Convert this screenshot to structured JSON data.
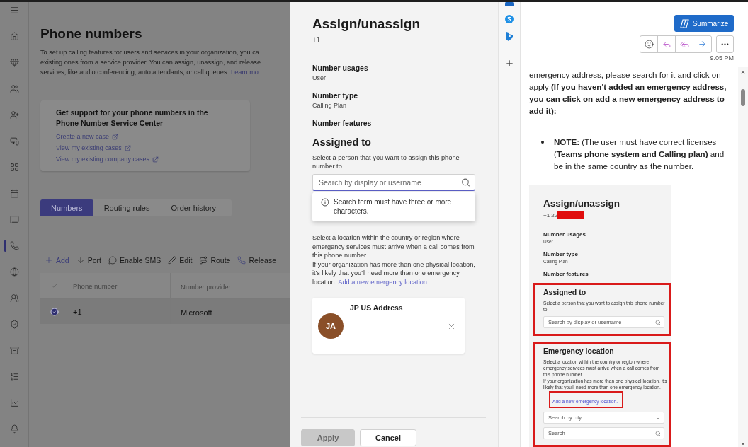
{
  "rail": {
    "items": [
      {
        "selected": false
      },
      {
        "selected": false
      },
      {
        "selected": false
      },
      {
        "selected": false
      },
      {
        "selected": false
      },
      {
        "selected": false
      },
      {
        "selected": false
      },
      {
        "selected": false
      },
      {
        "selected": false
      },
      {
        "selected": true
      },
      {
        "selected": false
      },
      {
        "selected": false
      },
      {
        "selected": false
      },
      {
        "selected": false
      },
      {
        "selected": false
      },
      {
        "selected": false
      },
      {
        "selected": false
      }
    ]
  },
  "admin": {
    "title": "Phone numbers",
    "description": [
      "To set up calling features for users and services in your organization, you ca",
      "existing ones from a service provider. You can assign, unassign, and release",
      "services, like audio conferencing, auto attendants, or call queues."
    ],
    "learn_more": "Learn mo",
    "support": {
      "title": "Get support for your phone numbers in the Phone Number Service Center",
      "links": [
        "Create a new case",
        "View my existing cases",
        "View my existing company cases"
      ]
    },
    "tabs": [
      {
        "label": "Numbers",
        "selected": true
      },
      {
        "label": "Routing rules",
        "selected": false
      },
      {
        "label": "Order history",
        "selected": false
      }
    ],
    "toolbar": [
      {
        "label": "Add",
        "kind": "add"
      },
      {
        "label": "Port",
        "kind": "port"
      },
      {
        "label": "Enable SMS",
        "kind": "sms"
      },
      {
        "label": "Edit",
        "kind": "edit"
      },
      {
        "label": "Route",
        "kind": "route"
      },
      {
        "label": "Release",
        "kind": "release"
      }
    ],
    "table": {
      "columns": [
        "Phone number",
        "Number provider"
      ],
      "rows": [
        {
          "selected": true,
          "cells": [
            "+1",
            "Microsoft"
          ]
        }
      ]
    }
  },
  "panel": {
    "title": "Assign/unassign",
    "number": "+1",
    "fields": [
      {
        "label": "Number usages",
        "value": "User"
      },
      {
        "label": "Number type",
        "value": "Calling Plan"
      },
      {
        "label": "Number features"
      }
    ],
    "assigned": {
      "heading": "Assigned to",
      "help": "Select a person that you want to assign this phone number to",
      "placeholder": "Search by display or username",
      "popup": "Search term must have three or more characters."
    },
    "emergency": {
      "description": "Select a location within the country or region where emergency services must arrive when a call comes from this phone number.",
      "more": "If your organization has more than one physical location, it's likely that you'll need more than one emergency location.",
      "link": "Add a new emergency location",
      "after_link": "."
    },
    "location": {
      "initials": "JA",
      "name": "JP US Address"
    },
    "buttons": [
      {
        "label": "Apply",
        "disabled": true
      },
      {
        "label": "Cancel",
        "disabled": false
      }
    ]
  },
  "email": {
    "summarize": "Summarize",
    "time": "9:05 PM",
    "paragraph": "emergency address, please search for it and click on apply **(If you haven't added an emergency address, you can click on add a new emergency address to add it):**",
    "note": "**NOTE:** (The user must have correct licenses (**Teams phone system and Calling plan)** and be in the same country as the number.",
    "screenshot": {
      "title": "Assign/unassign",
      "number": "+1 22",
      "fields": [
        {
          "label": "Number usages",
          "value": "User"
        },
        {
          "label": "Number type",
          "value": "Calling Plan"
        },
        {
          "label": "Number features"
        }
      ],
      "assigned": {
        "heading": "Assigned to",
        "help": "Select a person that you want to assign this phone number to",
        "placeholder": "Search by display or username"
      },
      "emergency": {
        "heading": "Emergency location",
        "description": "Select a location within the country or region where emergency services must arrive when a call comes from this phone number.",
        "more": "If your organization has more than one physical location, it's likely that you'll need more than one emergency location.",
        "link": "Add a new emergency location.",
        "city_placeholder": "Search by city",
        "search_placeholder": "Search"
      }
    }
  }
}
